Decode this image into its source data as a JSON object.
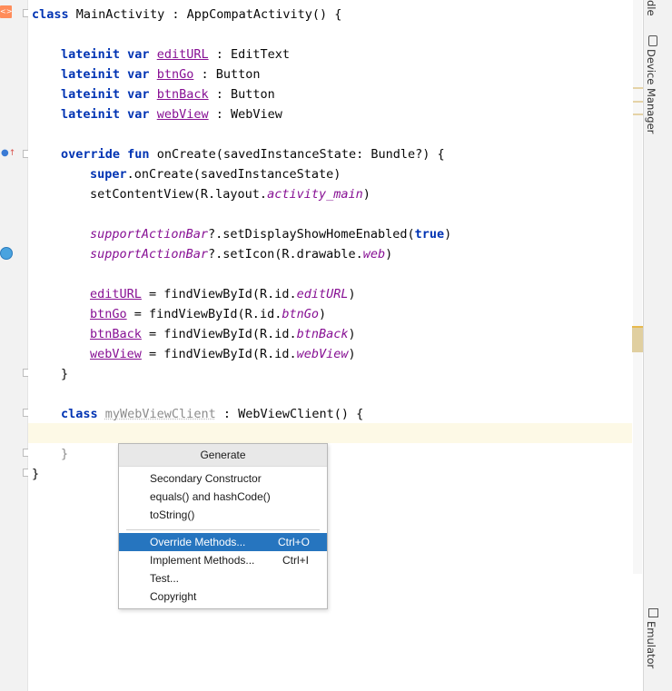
{
  "code": {
    "l1": {
      "kw": "class",
      "rest": " MainActivity : AppCompatActivity() {"
    },
    "l2": {
      "kw1": "lateinit",
      "kw2": "var",
      "name": "editURL",
      "rest": " : EditText"
    },
    "l3": {
      "kw1": "lateinit",
      "kw2": "var",
      "name": "btnGo",
      "rest": " : Button"
    },
    "l4": {
      "kw1": "lateinit",
      "kw2": "var",
      "name": "btnBack",
      "rest": " : Button"
    },
    "l5": {
      "kw1": "lateinit",
      "kw2": "var",
      "name": "webView",
      "rest": " : WebView"
    },
    "l6": {
      "kw1": "override",
      "kw2": "fun",
      "rest": " onCreate(savedInstanceState: Bundle?) {"
    },
    "l7": {
      "kw": "super",
      "rest": ".onCreate(savedInstanceState)"
    },
    "l8": {
      "pre": "setContentView(R.layout.",
      "it": "activity_main",
      "post": ")"
    },
    "l9": {
      "prop": "supportActionBar",
      "mid": "?.setDisplayShowHomeEnabled(",
      "kw": "true",
      "post": ")"
    },
    "l10": {
      "prop": "supportActionBar",
      "mid": "?.setIcon(R.drawable.",
      "it": "web",
      "post": ")"
    },
    "l11": {
      "name": "editURL",
      "mid": " = findViewById(R.id.",
      "it": "editURL",
      "post": ")"
    },
    "l12": {
      "name": "btnGo",
      "mid": " = findViewById(R.id.",
      "it": "btnGo",
      "post": ")"
    },
    "l13": {
      "name": "btnBack",
      "mid": " = findViewById(R.id.",
      "it": "btnBack",
      "post": ")"
    },
    "l14": {
      "name": "webView",
      "mid": " = findViewById(R.id.",
      "it": "webView",
      "post": ")"
    },
    "l15": {
      "text": "}"
    },
    "l16": {
      "kw": "class",
      "unused": "myWebViewClient",
      "rest": " : WebViewClient() {"
    },
    "l17": {
      "text": "}"
    },
    "l18": {
      "text": "}"
    }
  },
  "right_panel": {
    "top_fragment": "dle",
    "device_manager": "Device Manager",
    "emulator": "Emulator"
  },
  "popup": {
    "title": "Generate",
    "items": [
      {
        "label": "Secondary Constructor",
        "shortcut": ""
      },
      {
        "label": "equals() and hashCode()",
        "shortcut": ""
      },
      {
        "label": "toString()",
        "shortcut": ""
      },
      {
        "label": "Override Methods...",
        "shortcut": "Ctrl+O"
      },
      {
        "label": "Implement Methods...",
        "shortcut": "Ctrl+I"
      },
      {
        "label": "Test...",
        "shortcut": ""
      },
      {
        "label": "Copyright",
        "shortcut": ""
      }
    ],
    "selected": "Override Methods..."
  },
  "colors": {
    "keyword": "#0033b3",
    "property": "#871094",
    "selection": "#2675bf",
    "current_line": "#fdf9e6"
  },
  "icons": [
    "kotlin-class-icon",
    "override-icon",
    "web-drawable-icon",
    "fold-icon",
    "device-manager-icon",
    "emulator-icon"
  ]
}
